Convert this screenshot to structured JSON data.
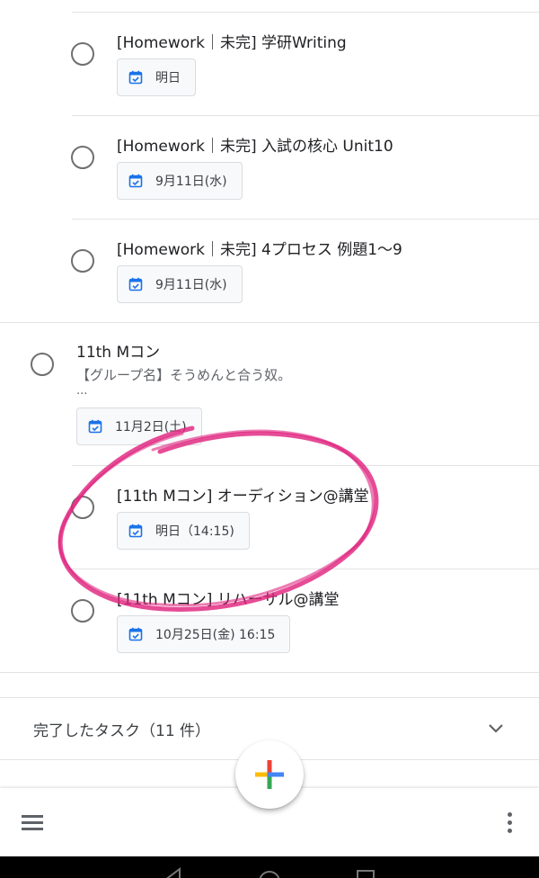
{
  "tasks": [
    {
      "title": "[Homework｜未完] 学研Writing",
      "date": "明日"
    },
    {
      "title": "[Homework｜未完] 入試の核心 Unit10",
      "date": "9月11日(水)"
    },
    {
      "title": "[Homework｜未完] 4プロセス 例題1～9",
      "date": "9月11日(水)"
    }
  ],
  "parent_task": {
    "title": "11th Mコン",
    "notes": "【グループ名】そうめんと合う奴。",
    "notes_more": "...",
    "date": "11月2日(土)"
  },
  "subtasks": [
    {
      "title": "[11th Mコン] オーディション@講堂",
      "date": "明日（14:15)"
    },
    {
      "title": "[11th Mコン] リハーサル@講堂",
      "date": "10月25日(金) 16:15"
    }
  ],
  "completed": {
    "label": "完了したタスク（11 件）"
  },
  "icons": {
    "checkbox": "radio-circle-icon",
    "date": "calendar-icon",
    "chevron": "chevron-down-icon",
    "menu": "hamburger-menu-icon",
    "more": "more-vertical-icon",
    "add": "plus-icon"
  },
  "colors": {
    "accent_blue": "#1a73e8",
    "annotation_pink": "#e0257f",
    "plus_red": "#ea4335",
    "plus_yellow": "#fbbc04",
    "plus_green": "#34a853",
    "plus_blue": "#4285f4"
  }
}
